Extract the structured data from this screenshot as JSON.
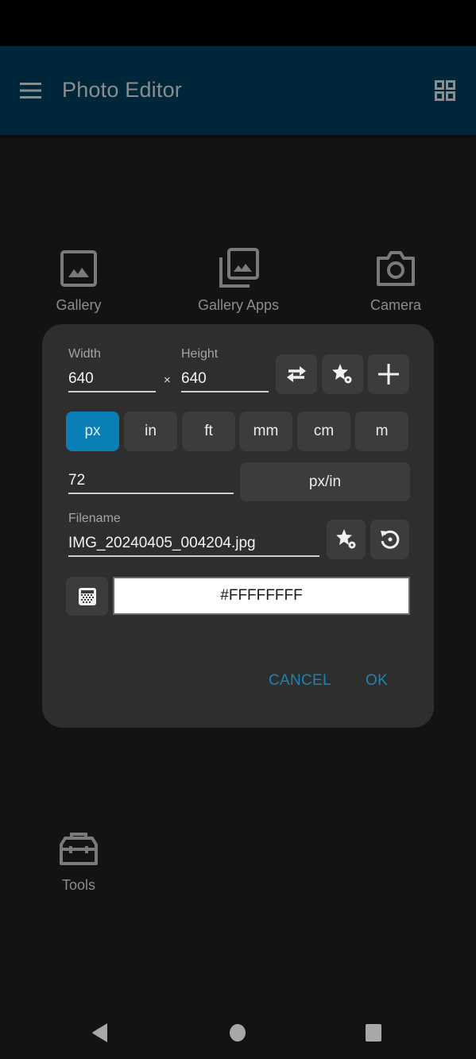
{
  "app_bar": {
    "title": "Photo Editor",
    "menu_icon": "hamburger-menu-icon",
    "grid_icon": "grid-view-icon",
    "background_color": "#00263a"
  },
  "launcher": {
    "items": [
      {
        "label": "Gallery",
        "icon": "image-icon"
      },
      {
        "label": "Gallery Apps",
        "icon": "image-stack-icon"
      },
      {
        "label": "Camera",
        "icon": "camera-icon"
      },
      {
        "label": "Tools",
        "icon": "toolbox-icon"
      }
    ]
  },
  "dialog": {
    "width_label": "Width",
    "width_value": "640",
    "times_symbol": "×",
    "height_label": "Height",
    "height_value": "640",
    "buttons": {
      "swap_icon": "swap-arrows-icon",
      "presets_icon": "star-settings-icon",
      "add_icon": "plus-icon"
    },
    "units": [
      {
        "label": "px",
        "active": true
      },
      {
        "label": "in",
        "active": false
      },
      {
        "label": "ft",
        "active": false
      },
      {
        "label": "mm",
        "active": false
      },
      {
        "label": "cm",
        "active": false
      },
      {
        "label": "m",
        "active": false
      }
    ],
    "resolution_value": "72",
    "resolution_unit": "px/in",
    "filename_label": "Filename",
    "filename_value": "IMG_20240405_004204.jpg",
    "filename_presets_icon": "star-settings-icon",
    "filename_reset_icon": "restore-icon",
    "background_icon": "transparency-checker-icon",
    "background_color_value": "#FFFFFFFF",
    "cancel_label": "CANCEL",
    "ok_label": "OK",
    "accent_color": "#0a7fb5"
  },
  "nav_bar": {
    "back_icon": "back-triangle-icon",
    "home_icon": "home-circle-icon",
    "recents_icon": "recents-square-icon"
  }
}
